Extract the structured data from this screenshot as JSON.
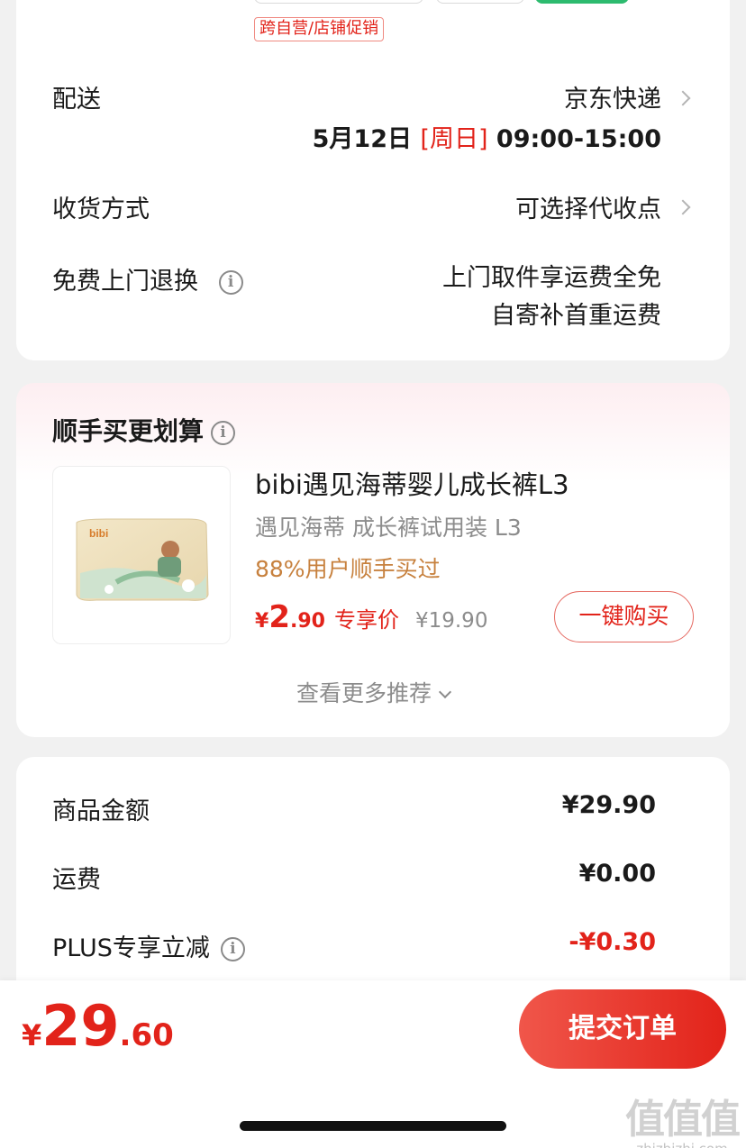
{
  "delivery": {
    "promo_tag": "跨自营/店铺促销",
    "shipping_label": "配送",
    "shipping_value": "京东快递",
    "date": "5月12日",
    "weekday": "[周日]",
    "time_slot": "09:00-15:00",
    "receive_label": "收货方式",
    "receive_value": "可选择代收点",
    "return_label": "免费上门退换",
    "return_line1": "上门取件享运费全免",
    "return_line2": "自寄补首重运费"
  },
  "recommend": {
    "title": "顺手买更划算",
    "product": {
      "brand_text": "bibi",
      "name": "bibi遇见海蒂婴儿成长裤L3",
      "subtitle": "遇见海蒂 成长裤试用装 L3",
      "buy_rate": "88%用户顺手买过",
      "price_yen": "¥",
      "price_int": "2",
      "price_dec": ".90",
      "price_tag": "专享价",
      "original_price": "¥19.90",
      "buy_button": "一键购买"
    },
    "see_more": "查看更多推荐"
  },
  "summary": {
    "items": [
      {
        "label": "商品金额",
        "value": "¥29.90"
      },
      {
        "label": "运费",
        "value": "¥0.00"
      },
      {
        "label": "PLUS专享立减",
        "value": "-¥0.30"
      }
    ]
  },
  "bottom": {
    "total_yen": "¥",
    "total_int": "29",
    "total_dec": ".60",
    "submit": "提交订单"
  },
  "watermark": {
    "logo": "值值值",
    "url": "zhizhizhi.com"
  },
  "colors": {
    "accent_red": "#e2231a",
    "promo_brown": "#c7813e",
    "muted_gray": "#8c8c8c"
  }
}
